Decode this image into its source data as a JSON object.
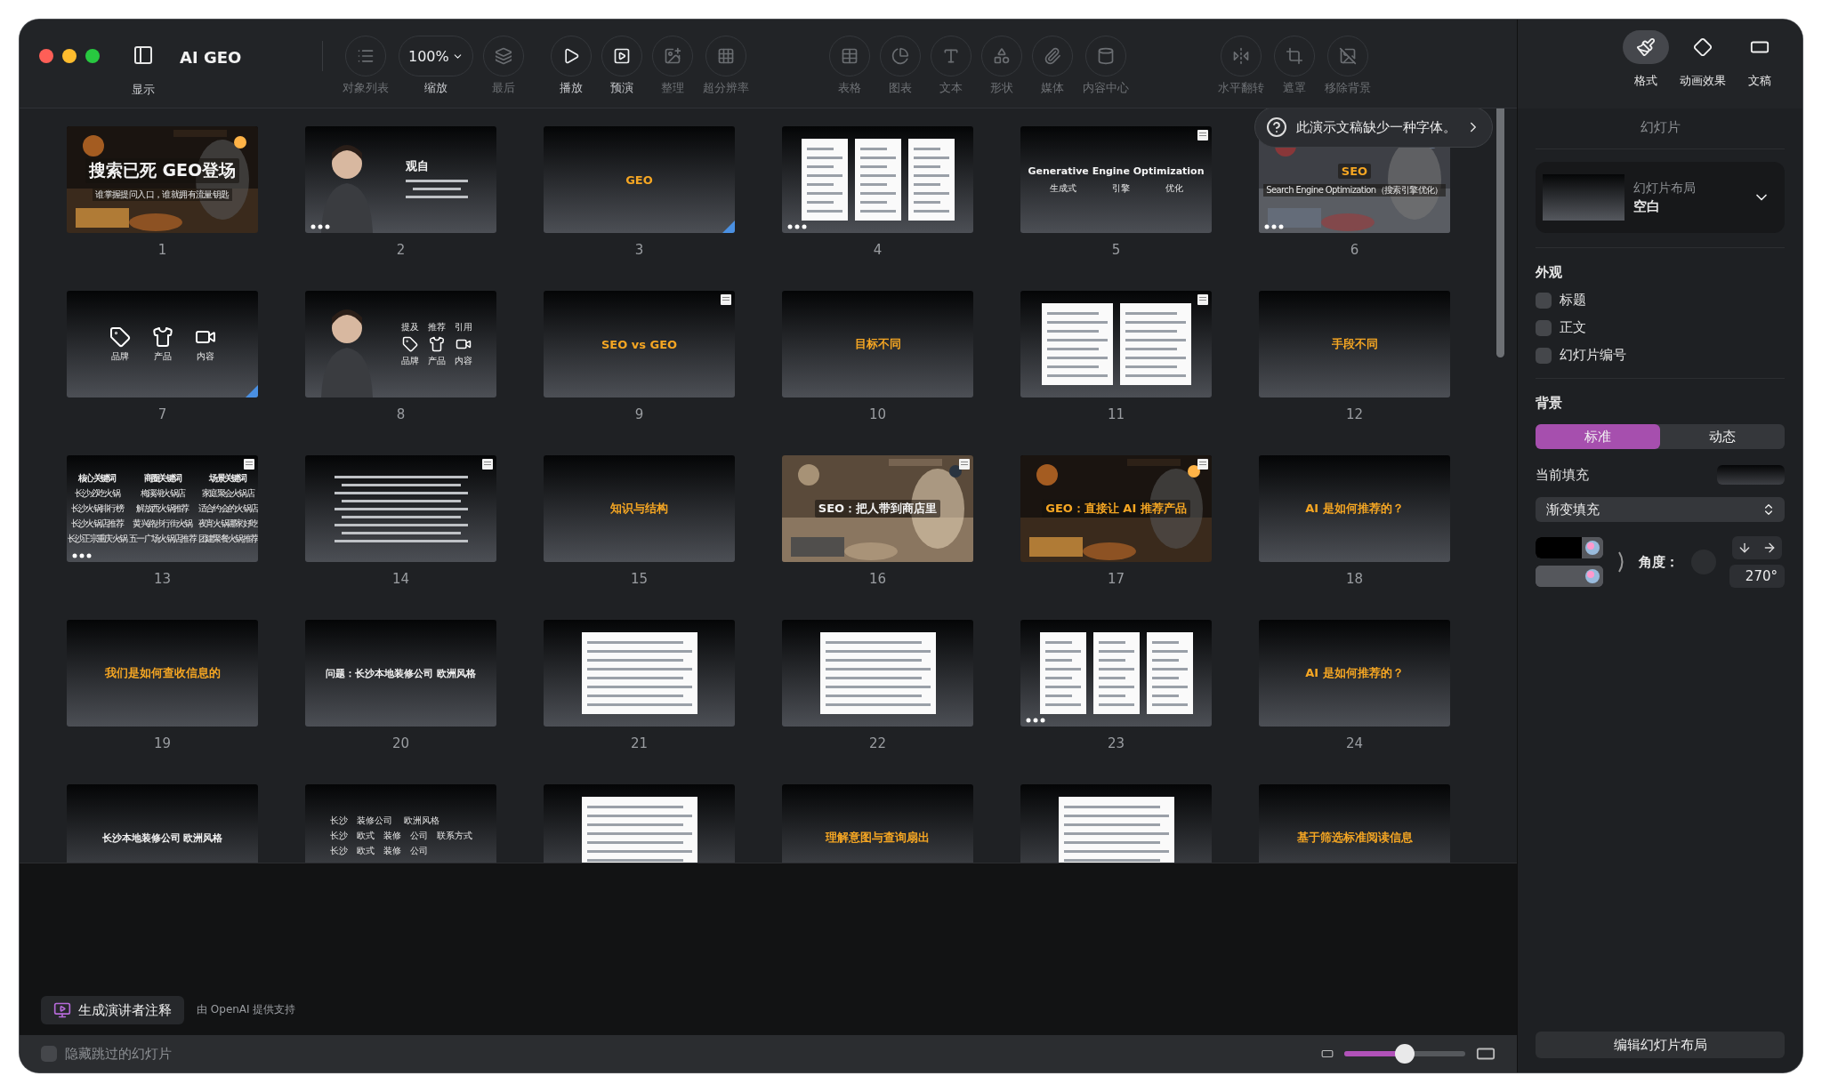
{
  "toolbar": {
    "view_label": "显示",
    "title": "AI GEO",
    "groups": [
      [
        {
          "kind": "icon",
          "label": "对象列表",
          "disabled": true
        },
        {
          "kind": "zoom",
          "value": "100%",
          "label": "缩放",
          "disabled": false
        },
        {
          "kind": "icon",
          "label": "最后",
          "disabled": true
        }
      ],
      [
        {
          "kind": "icon",
          "label": "播放",
          "disabled": false
        },
        {
          "kind": "icon",
          "label": "预演",
          "disabled": false
        },
        {
          "kind": "icon",
          "label": "整理",
          "disabled": true
        },
        {
          "kind": "icon",
          "label": "超分辨率",
          "disabled": true
        }
      ],
      [
        {
          "kind": "icon",
          "label": "表格",
          "disabled": true
        },
        {
          "kind": "icon",
          "label": "图表",
          "disabled": true
        },
        {
          "kind": "icon",
          "label": "文本",
          "disabled": true
        },
        {
          "kind": "icon",
          "label": "形状",
          "disabled": true
        },
        {
          "kind": "icon",
          "label": "媒体",
          "disabled": true
        },
        {
          "kind": "icon",
          "label": "内容中心",
          "disabled": true
        }
      ],
      [
        {
          "kind": "icon",
          "label": "水平翻转",
          "disabled": true
        },
        {
          "kind": "icon",
          "label": "遮罩",
          "disabled": true
        },
        {
          "kind": "icon",
          "label": "移除背景",
          "disabled": true
        }
      ]
    ]
  },
  "font_alert": {
    "message": "此演示文稿缺少一种字体。"
  },
  "slides": [
    {
      "number": "1",
      "kind": "picture",
      "title": "搜索已死 GEO登场",
      "subtitle": "谁掌握提问入口，谁就拥有流量钥匙",
      "accent": false,
      "note_mark": false,
      "build_mark": false,
      "transition_mark": false
    },
    {
      "number": "2",
      "kind": "person",
      "title": "观自",
      "accent": false,
      "note_mark": false,
      "build_mark": true,
      "transition_mark": false
    },
    {
      "number": "3",
      "kind": "title",
      "title": "GEO",
      "accent": true,
      "note_mark": false,
      "build_mark": false,
      "transition_mark": true
    },
    {
      "number": "4",
      "kind": "docs",
      "note_mark": false,
      "build_mark": true,
      "transition_mark": false
    },
    {
      "number": "5",
      "kind": "subtitle",
      "title": "Generative Engine Optimization",
      "items": [
        "生成式",
        "引擎",
        "优化"
      ],
      "accent": false,
      "note_mark": true,
      "build_mark": false,
      "transition_mark": false
    },
    {
      "number": "6",
      "kind": "picture",
      "title": "SEO",
      "subtitle": "Search Engine Optimization（搜索引擎优化）",
      "accent": true,
      "note_mark": false,
      "build_mark": true,
      "transition_mark": false
    },
    {
      "number": "7",
      "kind": "icons",
      "labels": [
        "品牌",
        "产品",
        "内容"
      ],
      "note_mark": false,
      "build_mark": false,
      "transition_mark": true
    },
    {
      "number": "8",
      "kind": "person",
      "tops": [
        "提及",
        "推荐",
        "引用"
      ],
      "labels": [
        "品牌",
        "产品",
        "内容"
      ],
      "note_mark": false,
      "build_mark": false,
      "transition_mark": false
    },
    {
      "number": "9",
      "kind": "title",
      "title": "SEO vs GEO",
      "accent": true,
      "note_mark": true,
      "build_mark": false,
      "transition_mark": false
    },
    {
      "number": "10",
      "kind": "title",
      "title": "目标不同",
      "accent": true,
      "note_mark": false,
      "build_mark": false,
      "transition_mark": false
    },
    {
      "number": "11",
      "kind": "docs",
      "note_mark": true,
      "build_mark": false,
      "transition_mark": false
    },
    {
      "number": "12",
      "kind": "title",
      "title": "手段不同",
      "accent": true,
      "note_mark": false,
      "build_mark": false,
      "transition_mark": false
    },
    {
      "number": "13",
      "kind": "table",
      "headers": [
        "核心关键词",
        "商圈关键词",
        "场景关键词"
      ],
      "rows": [
        [
          "长沙必吃火锅",
          "梅溪湖火锅店",
          "家庭聚会火锅店"
        ],
        [
          "长沙火锅排行榜",
          "解放西火锅推荐",
          "适合约会的火锅店"
        ],
        [
          "长沙火锅店推荐",
          "黄兴路步行街火锅",
          "夜宵火锅哪家好吃"
        ],
        [
          "长沙正宗重庆火锅",
          "五一广场火锅店推荐",
          "团建聚餐火锅推荐"
        ]
      ],
      "note_mark": true,
      "build_mark": true,
      "transition_mark": false
    },
    {
      "number": "14",
      "kind": "text",
      "note_mark": true,
      "build_mark": false,
      "transition_mark": false
    },
    {
      "number": "15",
      "kind": "title",
      "title": "知识与结构",
      "accent": true,
      "note_mark": false,
      "build_mark": false,
      "transition_mark": false
    },
    {
      "number": "16",
      "kind": "picture",
      "title": "SEO：把人带到商店里",
      "accent": false,
      "note_mark": true,
      "build_mark": false,
      "transition_mark": false
    },
    {
      "number": "17",
      "kind": "picture",
      "title": "GEO：直接让 AI 推荐产品",
      "accent": true,
      "note_mark": true,
      "build_mark": false,
      "transition_mark": false
    },
    {
      "number": "18",
      "kind": "title",
      "title": "AI 是如何推荐的？",
      "accent": true,
      "note_mark": false,
      "build_mark": false,
      "transition_mark": false
    },
    {
      "number": "19",
      "kind": "title",
      "title": "我们是如何查收信息的",
      "accent": true,
      "note_mark": false,
      "build_mark": false,
      "transition_mark": false
    },
    {
      "number": "20",
      "kind": "title",
      "title": "问题：长沙本地装修公司 欧洲风格",
      "accent": false,
      "note_mark": false,
      "build_mark": false,
      "transition_mark": false
    },
    {
      "number": "21",
      "kind": "docs",
      "note_mark": false,
      "build_mark": false,
      "transition_mark": false
    },
    {
      "number": "22",
      "kind": "docs",
      "note_mark": false,
      "build_mark": false,
      "transition_mark": false
    },
    {
      "number": "23",
      "kind": "docs",
      "note_mark": false,
      "build_mark": true,
      "transition_mark": false
    },
    {
      "number": "24",
      "kind": "title",
      "title": "AI 是如何推荐的？",
      "accent": true,
      "note_mark": false,
      "build_mark": false,
      "transition_mark": false
    },
    {
      "kind": "title",
      "title": "长沙本地装修公司 欧洲风格",
      "accent": false,
      "note_mark": false,
      "build_mark": false,
      "transition_mark": false
    },
    {
      "kind": "lines",
      "lines": [
        "长沙　装修公司　 欧洲风格",
        "长沙　欧式　装修　公司　联系方式",
        "长沙　欧式　装修　公司"
      ],
      "note_mark": false,
      "build_mark": false,
      "transition_mark": false
    },
    {
      "kind": "docs",
      "note_mark": false,
      "build_mark": false,
      "transition_mark": false
    },
    {
      "kind": "title",
      "title": "理解意图与查询扇出",
      "accent": true,
      "note_mark": false,
      "build_mark": false,
      "transition_mark": false
    },
    {
      "kind": "docs",
      "note_mark": false,
      "build_mark": false,
      "transition_mark": false
    },
    {
      "kind": "title",
      "title": "基于筛选标准阅读信息",
      "accent": true,
      "note_mark": false,
      "build_mark": false,
      "transition_mark": false
    }
  ],
  "notes": {
    "generate_button": "生成演讲者注释",
    "credit": "由 OpenAI 提供支持"
  },
  "bottom_bar": {
    "hide_skipped": {
      "label": "隐藏跳过的幻灯片",
      "checked": false
    },
    "thumb_size": {
      "level": 0.5
    }
  },
  "inspector": {
    "tabs": [
      {
        "label": "格式",
        "selected": true
      },
      {
        "label": "动画效果",
        "selected": false
      },
      {
        "label": "文稿",
        "selected": false
      }
    ],
    "section_title": "幻灯片",
    "layout": {
      "label": "幻灯片布局",
      "value": "空白"
    },
    "appearance": {
      "heading": "外观",
      "options": [
        {
          "label": "标题",
          "checked": false
        },
        {
          "label": "正文",
          "checked": false
        },
        {
          "label": "幻灯片编号",
          "checked": false
        }
      ]
    },
    "background": {
      "heading": "背景",
      "modes": [
        {
          "label": "标准",
          "selected": true
        },
        {
          "label": "动态",
          "selected": false
        }
      ],
      "current_fill_label": "当前填充",
      "fill_type": "渐变填充",
      "angle_label": "角度：",
      "angle_value": "270°"
    },
    "edit_layout_button": "编辑幻灯片布局"
  }
}
